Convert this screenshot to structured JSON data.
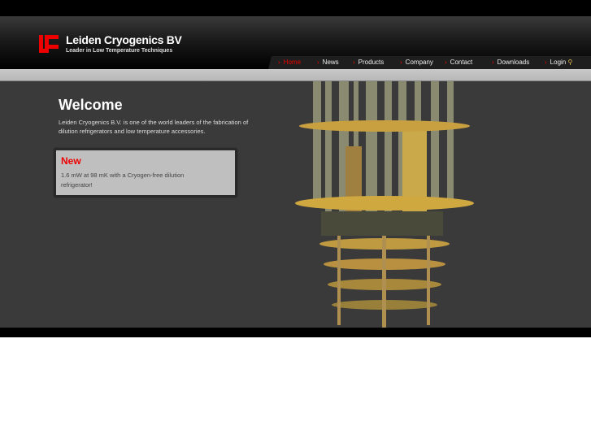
{
  "header": {
    "brand": "Leiden Cryogenics BV",
    "tagline": "Leader in Low Temperature Techniques"
  },
  "nav": {
    "items": [
      {
        "label": "Home",
        "active": true
      },
      {
        "label": "News"
      },
      {
        "label": "Products"
      },
      {
        "label": "Company"
      },
      {
        "label": "Contact"
      },
      {
        "label": "Downloads"
      },
      {
        "label": "Login"
      }
    ]
  },
  "main": {
    "title": "Welcome",
    "intro": "Leiden Cryogenics B.V. is one of the world leaders of the fabrication of dilution refrigerators and low temperature accessories.",
    "news": {
      "title": "New",
      "text": "1.6 mW at 98 mK with a Cryogen-free dilution refrigerator!"
    }
  },
  "colors": {
    "accent": "#e00000",
    "main_bg": "#3a3a3a"
  }
}
